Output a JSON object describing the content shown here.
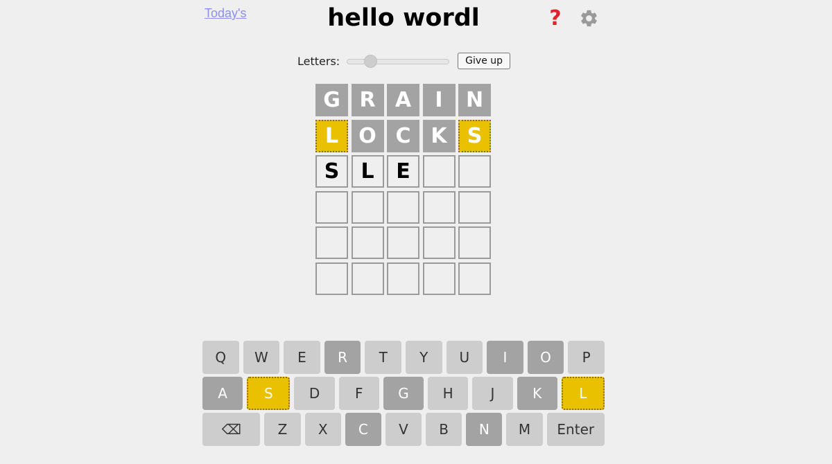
{
  "header": {
    "todays_link": "Today's",
    "title": "hello wordl",
    "help_icon": "question-mark-icon",
    "settings_icon": "gear-icon",
    "help_color": "#e0232a",
    "settings_color": "#9a9a9a"
  },
  "controls": {
    "letters_label": "Letters:",
    "letters_value": 5,
    "letters_min": 4,
    "letters_max": 11,
    "giveup_label": "Give up"
  },
  "colors": {
    "absent": "#a3a3a3",
    "elsewhere": "#e9c100",
    "empty_border": "#9a9a9a"
  },
  "board": {
    "rows": [
      [
        {
          "letter": "G",
          "state": "absent"
        },
        {
          "letter": "R",
          "state": "absent"
        },
        {
          "letter": "A",
          "state": "absent"
        },
        {
          "letter": "I",
          "state": "absent"
        },
        {
          "letter": "N",
          "state": "absent"
        }
      ],
      [
        {
          "letter": "L",
          "state": "elsewhere"
        },
        {
          "letter": "O",
          "state": "absent"
        },
        {
          "letter": "C",
          "state": "absent"
        },
        {
          "letter": "K",
          "state": "absent"
        },
        {
          "letter": "S",
          "state": "elsewhere"
        }
      ],
      [
        {
          "letter": "S",
          "state": "editing"
        },
        {
          "letter": "L",
          "state": "editing"
        },
        {
          "letter": "E",
          "state": "editing"
        },
        {
          "letter": "",
          "state": "empty"
        },
        {
          "letter": "",
          "state": "empty"
        }
      ],
      [
        {
          "letter": "",
          "state": "empty"
        },
        {
          "letter": "",
          "state": "empty"
        },
        {
          "letter": "",
          "state": "empty"
        },
        {
          "letter": "",
          "state": "empty"
        },
        {
          "letter": "",
          "state": "empty"
        }
      ],
      [
        {
          "letter": "",
          "state": "empty"
        },
        {
          "letter": "",
          "state": "empty"
        },
        {
          "letter": "",
          "state": "empty"
        },
        {
          "letter": "",
          "state": "empty"
        },
        {
          "letter": "",
          "state": "empty"
        }
      ],
      [
        {
          "letter": "",
          "state": "empty"
        },
        {
          "letter": "",
          "state": "empty"
        },
        {
          "letter": "",
          "state": "empty"
        },
        {
          "letter": "",
          "state": "empty"
        },
        {
          "letter": "",
          "state": "empty"
        }
      ]
    ]
  },
  "keyboard": {
    "rows": [
      [
        {
          "label": "Q",
          "state": ""
        },
        {
          "label": "W",
          "state": ""
        },
        {
          "label": "E",
          "state": ""
        },
        {
          "label": "R",
          "state": "absent"
        },
        {
          "label": "T",
          "state": ""
        },
        {
          "label": "Y",
          "state": ""
        },
        {
          "label": "U",
          "state": ""
        },
        {
          "label": "I",
          "state": "absent"
        },
        {
          "label": "O",
          "state": "absent"
        },
        {
          "label": "P",
          "state": ""
        }
      ],
      [
        {
          "label": "A",
          "state": "absent"
        },
        {
          "label": "S",
          "state": "elsewhere"
        },
        {
          "label": "D",
          "state": ""
        },
        {
          "label": "F",
          "state": ""
        },
        {
          "label": "G",
          "state": "absent"
        },
        {
          "label": "H",
          "state": ""
        },
        {
          "label": "J",
          "state": ""
        },
        {
          "label": "K",
          "state": "absent"
        },
        {
          "label": "L",
          "state": "elsewhere"
        }
      ],
      [
        {
          "label": "⌫",
          "state": "",
          "wide": true,
          "name": "backspace-key"
        },
        {
          "label": "Z",
          "state": ""
        },
        {
          "label": "X",
          "state": ""
        },
        {
          "label": "C",
          "state": "absent"
        },
        {
          "label": "V",
          "state": ""
        },
        {
          "label": "B",
          "state": ""
        },
        {
          "label": "N",
          "state": "absent"
        },
        {
          "label": "M",
          "state": ""
        },
        {
          "label": "Enter",
          "state": "",
          "wide": true,
          "name": "enter-key"
        }
      ]
    ]
  }
}
